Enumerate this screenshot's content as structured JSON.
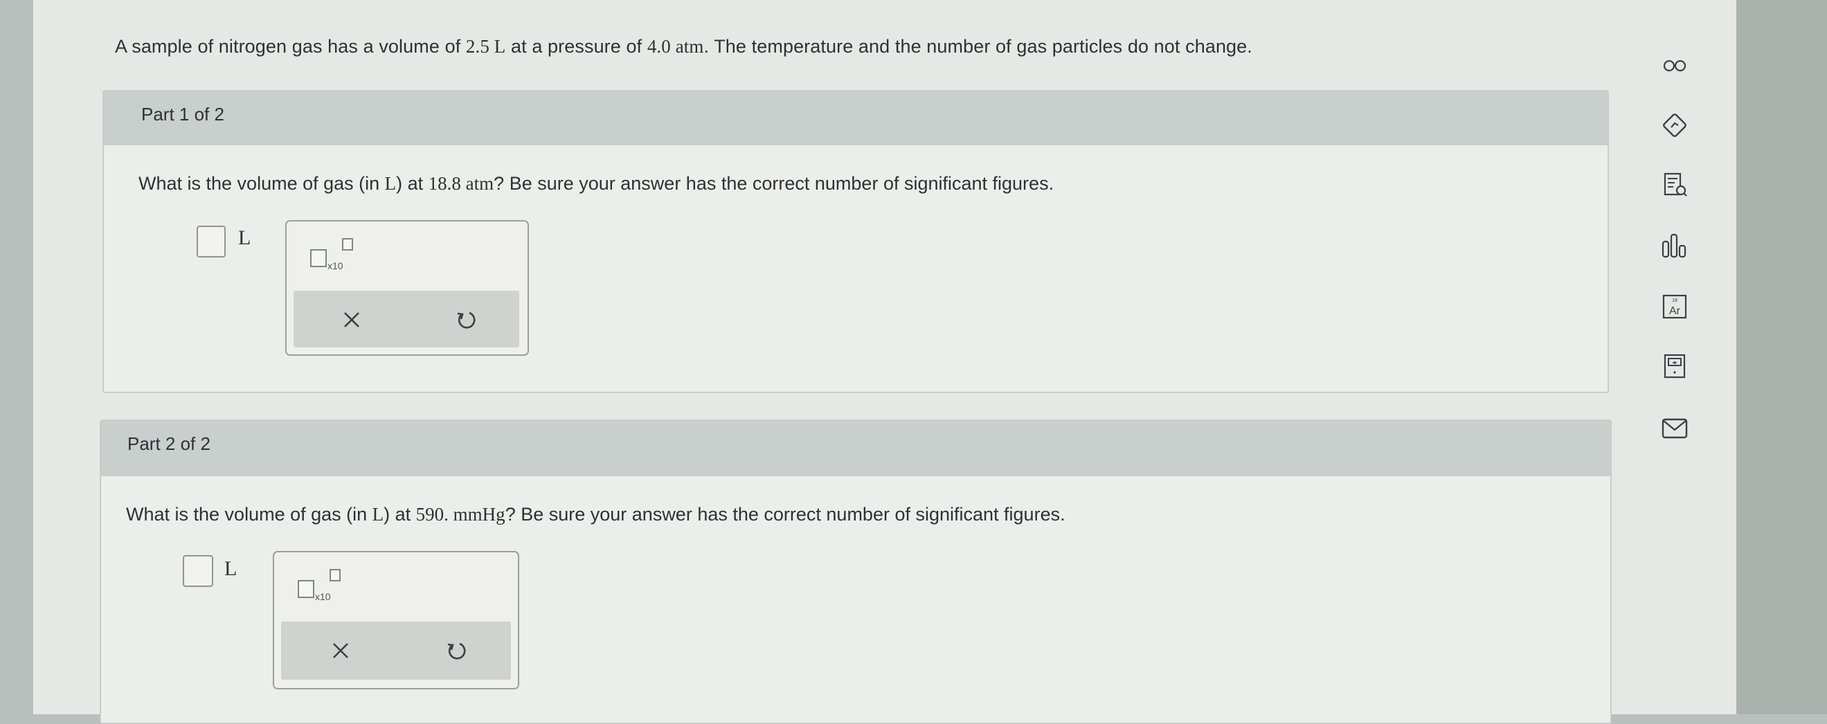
{
  "problem": {
    "p1": "A sample of nitrogen gas has a volume of ",
    "volume": "2.5 L",
    "p2": " at a pressure of ",
    "pressure": "4.0 atm",
    "p3": ". The temperature and the number of gas particles do not change."
  },
  "parts": [
    {
      "header": "Part 1 of 2",
      "q1": "What is the volume of gas (in ",
      "unit_in": "L",
      "q2": ") at ",
      "given": "18.8 atm",
      "q3": "? Be sure your answer has the correct number of significant figures.",
      "answer_unit": "L",
      "x10_label": "x10"
    },
    {
      "header": "Part 2 of 2",
      "q1": "What is the volume of gas (in ",
      "unit_in": "L",
      "q2": ") at ",
      "given": "590. mmHg",
      "q3": "? Be sure your answer has the correct number of significant figures.",
      "answer_unit": "L",
      "x10_label": "x10"
    }
  ],
  "colors": {
    "screen_bg": "#e6e8e5",
    "panel_header": "#c9cfcc",
    "icon_color": "#3b4045"
  },
  "sidebar_icons": [
    "infinity-icon",
    "hint-diamond-icon",
    "list-search-icon",
    "bar-chart-icon",
    "periodic-table-icon",
    "calculator-icon",
    "mail-icon"
  ]
}
